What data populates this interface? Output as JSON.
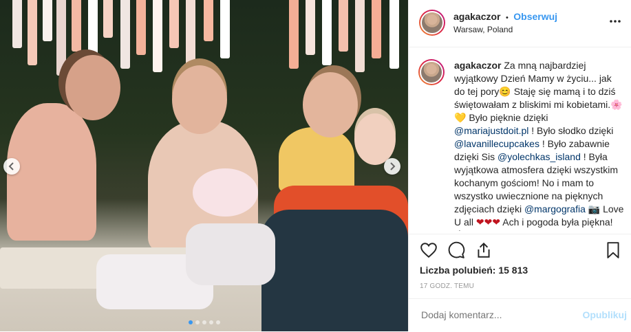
{
  "post": {
    "username": "agakaczor",
    "separator": "•",
    "follow_label": "Obserwuj",
    "location": "Warsaw, Poland",
    "more_icon": "ellipsis-icon"
  },
  "caption": {
    "username": "agakaczor",
    "seg1": " Za mną najbardziej wyjątkowy Dzień Mamy w życiu... jak do tej pory",
    "emoji1": "😊",
    "seg2": " Staję się mamą i to dziś świętowałam z bliskimi mi kobietami.",
    "emoji2": "🌸",
    "emoji3": "💛",
    "seg3": " Było pięknie dzięki ",
    "mention1": "@mariajustdoit.pl",
    "seg4": " ! Było słodko dzięki ",
    "mention2": "@lavanillecupcakes",
    "seg5": " ! Było zabawnie dzięki Sis ",
    "mention3": "@yolechkas_island",
    "seg6": " ! Była wyjątkowa atmosfera dzięki wszystkim kochanym gościom! No i mam to wszystko uwiecznione na pięknych zdjęciach dzięki ",
    "mention4": "@margografia",
    "emoji4": "📷",
    "seg7": " Love U all ",
    "emoji5": "❤❤❤",
    "seg8": " Ach i pogoda była piękna! ",
    "emoji6": "🌦"
  },
  "stats": {
    "likes_label": "Liczba polubień:",
    "likes_count": "15 813",
    "time_ago": "17 GODZ. TEMU"
  },
  "comment": {
    "placeholder": "Dodaj komentarz...",
    "publish_label": "Opublikuj"
  },
  "carousel": {
    "total_slides": 5,
    "active_slide": 1,
    "prev_icon": "chevron-left-icon",
    "next_icon": "chevron-right-icon"
  },
  "colors": {
    "accent": "#3897f0",
    "mention": "#003569",
    "muted": "#999999",
    "publish_disabled": "#b2dffc"
  }
}
